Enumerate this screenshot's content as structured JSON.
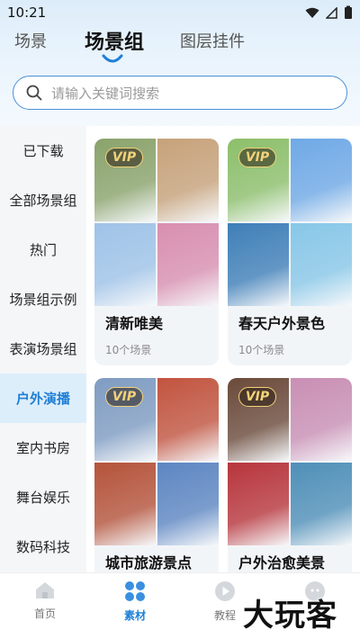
{
  "status_bar": {
    "time": "10:21"
  },
  "tabs": [
    {
      "label": "场景",
      "active": false
    },
    {
      "label": "场景组",
      "active": true
    },
    {
      "label": "图层挂件",
      "active": false
    }
  ],
  "search": {
    "placeholder": "请输入关键词搜索"
  },
  "sidebar": {
    "items": [
      {
        "label": "已下载"
      },
      {
        "label": "全部场景组"
      },
      {
        "label": "热门"
      },
      {
        "label": "场景组示例"
      },
      {
        "label": "表演场景组"
      },
      {
        "label": "户外演播",
        "active": true
      },
      {
        "label": "室内书房"
      },
      {
        "label": "舞台娱乐"
      },
      {
        "label": "数码科技"
      }
    ]
  },
  "cards": [
    {
      "title": "清新唯美",
      "count": "10个场景",
      "vip": "VIP",
      "tiles": [
        "#8aa36b",
        "#c7a27a",
        "#9fc3e8",
        "#d98fb0"
      ]
    },
    {
      "title": "春天户外景色",
      "count": "10个场景",
      "vip": "VIP",
      "tiles": [
        "#8cbf6a",
        "#6fa9e6",
        "#3f7fb8",
        "#88c7e8"
      ]
    },
    {
      "title": "城市旅游景点",
      "count": "",
      "vip": "VIP",
      "tiles": [
        "#7f9cc2",
        "#c2543f",
        "#b5533a",
        "#5d86c2"
      ]
    },
    {
      "title": "户外治愈美景",
      "count": "",
      "vip": "VIP",
      "tiles": [
        "#6b4a3a",
        "#c98fb4",
        "#b8353c",
        "#4f8fb8"
      ]
    }
  ],
  "bottom_nav": [
    {
      "label": "首页",
      "icon": "home-icon",
      "active": false
    },
    {
      "label": "素材",
      "icon": "grid-icon",
      "active": true
    },
    {
      "label": "教程",
      "icon": "play-icon",
      "active": false
    },
    {
      "label": "",
      "icon": "profile-icon",
      "active": false
    }
  ],
  "watermark": "大玩客",
  "colors": {
    "accent": "#1e7fd6",
    "search_border": "#4a90d9",
    "vip_gold": "#f3d27a"
  }
}
